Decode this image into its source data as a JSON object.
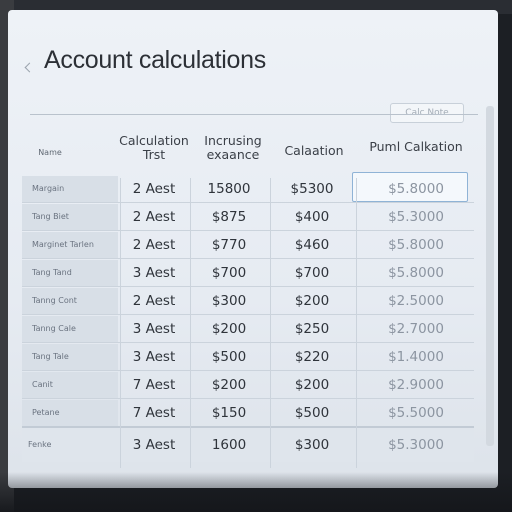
{
  "window": {
    "title": "Account calculations",
    "top_button_label": "Calc Note"
  },
  "table": {
    "headers": [
      "Name",
      "Calculation Trst",
      "Incrusing exaance",
      "Calaation",
      "Puml Calkation"
    ],
    "rows": [
      {
        "name": "Margain",
        "c1": "2 Aest",
        "c2": "15800",
        "c3": "$5300",
        "c4": "$5.8000"
      },
      {
        "name": "Tang Biet",
        "c1": "2 Aest",
        "c2": "$875",
        "c3": "$400",
        "c4": "$5.3000"
      },
      {
        "name": "Marginet Tarlen",
        "c1": "2 Aest",
        "c2": "$770",
        "c3": "$460",
        "c4": "$5.8000"
      },
      {
        "name": "Tang Tand",
        "c1": "3 Aest",
        "c2": "$700",
        "c3": "$700",
        "c4": "$5.8000"
      },
      {
        "name": "Tanng Cont",
        "c1": "2 Aest",
        "c2": "$300",
        "c3": "$200",
        "c4": "$2.5000"
      },
      {
        "name": "Tanng Cale",
        "c1": "3 Aest",
        "c2": "$200",
        "c3": "$250",
        "c4": "$2.7000"
      },
      {
        "name": "Tang Tale",
        "c1": "3 Aest",
        "c2": "$500",
        "c3": "$220",
        "c4": "$1.4000"
      },
      {
        "name": "Canit",
        "c1": "7 Aest",
        "c2": "$200",
        "c3": "$200",
        "c4": "$2.9000"
      },
      {
        "name": "Petane",
        "c1": "7 Aest",
        "c2": "$150",
        "c3": "$500",
        "c4": "$5.5000"
      }
    ],
    "summary": {
      "name": "Fenke",
      "c1": "3 Aest",
      "c2": "1600",
      "c3": "$300",
      "c4": "$5.3000"
    }
  }
}
